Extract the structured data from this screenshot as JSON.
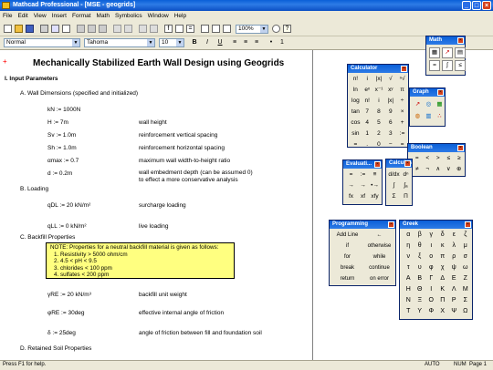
{
  "window": {
    "title": "Mathcad Professional - [MSE - geogrids]"
  },
  "menu": [
    "File",
    "Edit",
    "View",
    "Insert",
    "Format",
    "Math",
    "Symbolics",
    "Window",
    "Help"
  ],
  "toolbar": {
    "zoom": "100%"
  },
  "format_bar": {
    "style": "Normal",
    "font": "Tahoma",
    "size": "10",
    "bold": "B",
    "italic": "I",
    "underline": "U"
  },
  "doc": {
    "title": "Mechanically Stabilized Earth Wall Design using Geogrids",
    "sec1": "I. Input Parameters",
    "subA": "A. Wall Dimensions (specified and initialized)",
    "rows": [
      {
        "eq": "kN := 1000N",
        "desc": ""
      },
      {
        "eq": "H := 7m",
        "desc": "wall height"
      },
      {
        "eq": "Sv := 1.0m",
        "desc": "reinforcement vertical spacing"
      },
      {
        "eq": "Sh := 1.0m",
        "desc": "reinforcement horizontal spacing"
      },
      {
        "eq": "αmax := 0.7",
        "desc": "maximum wall width-to-height ratio"
      },
      {
        "eq": "d := 0.2m",
        "desc": "wall embedment depth (can be assumed 0)"
      }
    ],
    "desc_extra": "to effect a more conservative analysis",
    "subB": "B. Loading",
    "qDL": "qDL := 20 kN/m²",
    "qDL_desc": "surcharge loading",
    "qLL": "qLL := 0 kN/m²",
    "qLL_desc": "live loading",
    "subC": "C. Backfill Properties",
    "note": [
      "NOTE: Properties for a neutral backfill material is given as follows:",
      "1. Resistivity > 5000 ohm/cm",
      "2. 4.5 < pH < 9.5",
      "3. chlorides < 100 ppm",
      "4. sulfates < 200 ppm"
    ],
    "gammaRE": "γRE := 20 kN/m³",
    "gammaRE_desc": "backfill unit weight",
    "phiRE": "φRE := 30deg",
    "phiRE_desc": "effective internal angle of friction",
    "delta": "δ := 25deg",
    "delta_desc": "angle of friction between fill and foundation soil",
    "subD": "D. Retained Soil Properties"
  },
  "palettes": {
    "math": "Math",
    "calculator": "Calculator",
    "graph": "Graph",
    "boolean": "Boolean",
    "evaluation": "Evaluati...",
    "calculus": "Calculus",
    "programming": "Programming",
    "greek": "Greek",
    "calc_keys": [
      "n!",
      "i",
      "|x|",
      "√",
      "ⁿ√",
      "ln",
      "eˣ",
      "x⁻¹",
      "xʸ",
      "π",
      "log",
      "n!",
      "i",
      "|x|",
      "÷",
      "tan",
      "7",
      "8",
      "9",
      "×",
      "cos",
      "4",
      "5",
      "6",
      "+",
      "sin",
      "1",
      "2",
      "3",
      ":=",
      "=",
      ".",
      "0",
      "−",
      "="
    ],
    "bool_keys": [
      "=",
      "<",
      ">",
      "≤",
      "≥",
      "≠",
      "¬",
      "∧",
      "∨",
      "⊕"
    ],
    "eval_keys": [
      "=",
      ":=",
      "≡",
      "→",
      "→",
      "•→",
      "fx",
      "xf",
      "xfy"
    ],
    "prog_keys": [
      "Add Line",
      "←",
      "if",
      "otherwise",
      "for",
      "while",
      "break",
      "continue",
      "return",
      "on error"
    ],
    "greek_keys": [
      "α",
      "β",
      "γ",
      "δ",
      "ε",
      "ζ",
      "η",
      "θ",
      "ι",
      "κ",
      "λ",
      "μ",
      "ν",
      "ξ",
      "ο",
      "π",
      "ρ",
      "σ",
      "τ",
      "υ",
      "φ",
      "χ",
      "ψ",
      "ω",
      "Α",
      "Β",
      "Γ",
      "Δ",
      "Ε",
      "Ζ",
      "Η",
      "Θ",
      "Ι",
      "Κ",
      "Λ",
      "Μ",
      "Ν",
      "Ξ",
      "Ο",
      "Π",
      "Ρ",
      "Σ",
      "Τ",
      "Υ",
      "Φ",
      "Χ",
      "Ψ",
      "Ω"
    ]
  },
  "status": {
    "help": "Press F1 for help.",
    "auto": "AUTO",
    "num": "NUM",
    "page": "Page 1"
  }
}
